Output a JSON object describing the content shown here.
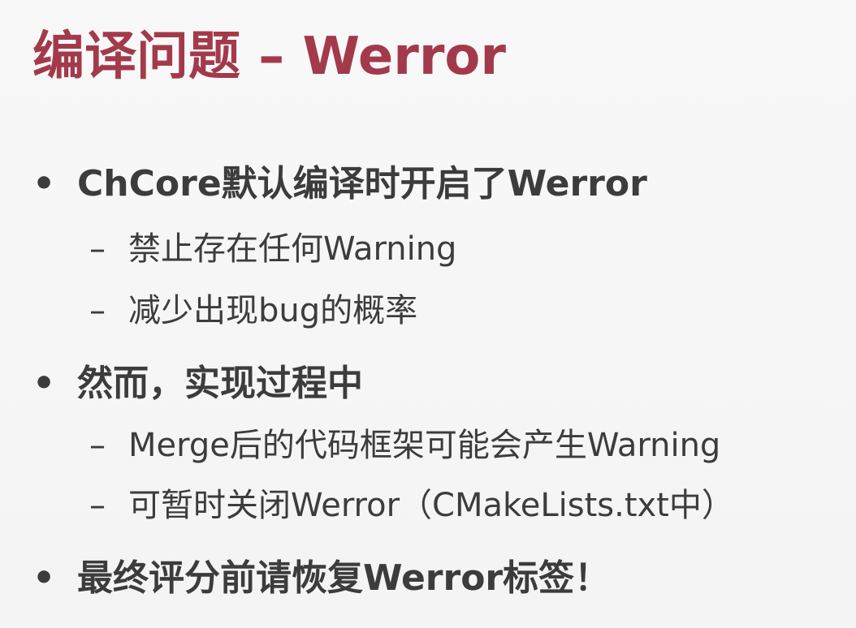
{
  "slide": {
    "title": "编译问题 – Werror",
    "bullet_mark": "•",
    "dash_mark": "–",
    "items": [
      {
        "text": "ChCore默认编译时开启了Werror",
        "subitems": [
          "禁止存在任何Warning",
          "减少出现bug的概率"
        ]
      },
      {
        "text": "然而，实现过程中",
        "subitems": [
          "Merge后的代码框架可能会产生Warning",
          "可暂时关闭Werror（CMakeLists.txt中）"
        ]
      },
      {
        "text": "最终评分前请恢复Werror标签！",
        "subitems": []
      }
    ]
  }
}
